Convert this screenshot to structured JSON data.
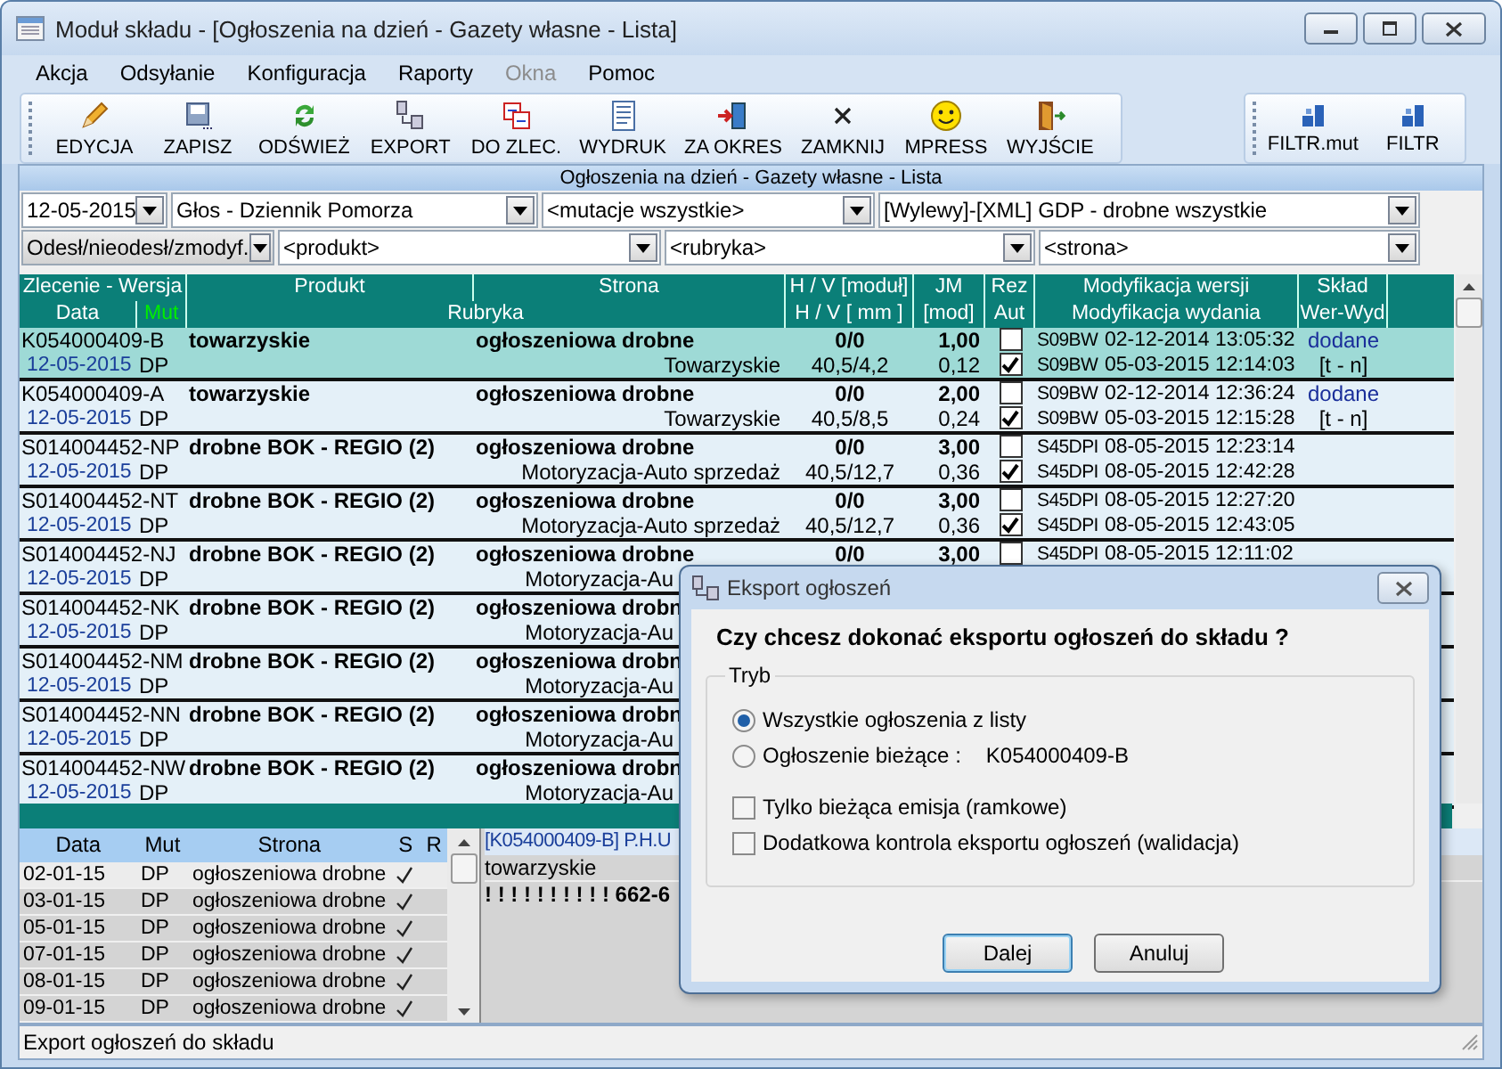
{
  "window": {
    "title": "Moduł składu - [Ogłoszenia na dzień - Gazety własne - Lista]"
  },
  "menu": [
    {
      "label": "Akcja",
      "disabled": false
    },
    {
      "label": "Odsyłanie",
      "disabled": false
    },
    {
      "label": "Konfiguracja",
      "disabled": false
    },
    {
      "label": "Raporty",
      "disabled": false
    },
    {
      "label": "Okna",
      "disabled": true
    },
    {
      "label": "Pomoc",
      "disabled": false
    }
  ],
  "toolbar": [
    "EDYCJA",
    "ZAPISZ",
    "ODŚWIEŻ",
    "EXPORT",
    "DO ZLEC.",
    "WYDRUK",
    "ZA OKRES",
    "ZAMKNIJ",
    "MPRESS",
    "WYJŚCIE"
  ],
  "toolbar_right": [
    "FILTR.mut",
    "FILTR"
  ],
  "panel_title": "Ogłoszenia na dzień - Gazety własne - Lista",
  "filters_row1": [
    "12-05-2015",
    "Głos - Dziennik Pomorza",
    "<mutacje wszystkie>",
    "[Wylewy]-[XML] GDP - drobne wszystkie"
  ],
  "filters_row2": [
    "Odesł/nieodesł/zmodyf.",
    "<produkt>",
    "<rubryka>",
    "<strona>"
  ],
  "table": {
    "header_top": [
      "Zlecenie - Wersja",
      "Produkt",
      "Strona",
      "H / V [moduł]",
      "JM",
      "Rez",
      "Modyfikacja wersji",
      "Skład"
    ],
    "header_bottom": [
      "Data",
      "Mut",
      "Rubryka",
      "H / V [  mm  ]",
      "[mod]",
      "Aut",
      "Modyfikacja wydania",
      "Wer-Wyd"
    ],
    "rows": [
      {
        "selected": true,
        "order": "K054000409-B",
        "product": "towarzyskie",
        "page": "ogłoszeniowa drobne",
        "hv_mod": "0/0",
        "jm": "1,00",
        "rez": false,
        "ver_code": "S09BW",
        "ver_time": "02-12-2014 13:05:32",
        "sklad": "dodane",
        "date": "12-05-2015",
        "mut": "DP",
        "rubric": "Towarzyskie",
        "hv_mm": "40,5/4,2",
        "jm_mod": "0,12",
        "aut": true,
        "ed_code": "S09BW",
        "ed_time": "05-03-2015 12:14:03",
        "sklad2": "[t - n]"
      },
      {
        "selected": false,
        "order": "K054000409-A",
        "product": "towarzyskie",
        "page": "ogłoszeniowa drobne",
        "hv_mod": "0/0",
        "jm": "2,00",
        "rez": false,
        "ver_code": "S09BW",
        "ver_time": "02-12-2014 12:36:24",
        "sklad": "dodane",
        "date": "12-05-2015",
        "mut": "DP",
        "rubric": "Towarzyskie",
        "hv_mm": "40,5/8,5",
        "jm_mod": "0,24",
        "aut": true,
        "ed_code": "S09BW",
        "ed_time": "05-03-2015 12:15:28",
        "sklad2": "[t - n]"
      },
      {
        "selected": false,
        "order": "S014004452-NP",
        "product": "drobne BOK - REGIO (2)",
        "page": "ogłoszeniowa drobne",
        "hv_mod": "0/0",
        "jm": "3,00",
        "rez": false,
        "ver_code": "S45DPI",
        "ver_time": "08-05-2015 12:23:14",
        "date": "12-05-2015",
        "mut": "DP",
        "rubric": "Motoryzacja-Auto sprzedaż",
        "hv_mm": "40,5/12,7",
        "jm_mod": "0,36",
        "aut": true,
        "ed_code": "S45DPI",
        "ed_time": "08-05-2015 12:42:28"
      },
      {
        "selected": false,
        "order": "S014004452-NT",
        "product": "drobne BOK - REGIO (2)",
        "page": "ogłoszeniowa drobne",
        "hv_mod": "0/0",
        "jm": "3,00",
        "rez": false,
        "ver_code": "S45DPI",
        "ver_time": "08-05-2015 12:27:20",
        "date": "12-05-2015",
        "mut": "DP",
        "rubric": "Motoryzacja-Auto sprzedaż",
        "hv_mm": "40,5/12,7",
        "jm_mod": "0,36",
        "aut": true,
        "ed_code": "S45DPI",
        "ed_time": "08-05-2015 12:43:05"
      },
      {
        "selected": false,
        "order": "S014004452-NJ",
        "product": "drobne BOK - REGIO (2)",
        "page": "ogłoszeniowa drobne",
        "hv_mod": "0/0",
        "jm": "3,00",
        "rez": false,
        "ver_code": "S45DPI",
        "ver_time": "08-05-2015 12:11:02",
        "date": "12-05-2015",
        "mut": "DP",
        "rubric": "Motoryzacja-Au"
      },
      {
        "selected": false,
        "order": "S014004452-NK",
        "product": "drobne BOK - REGIO (2)",
        "page": "ogłoszeniowa drobn",
        "date": "12-05-2015",
        "mut": "DP",
        "rubric": "Motoryzacja-Au"
      },
      {
        "selected": false,
        "order": "S014004452-NM",
        "product": "drobne BOK - REGIO (2)",
        "page": "ogłoszeniowa drobn",
        "date": "12-05-2015",
        "mut": "DP",
        "rubric": "Motoryzacja-Au"
      },
      {
        "selected": false,
        "order": "S014004452-NN",
        "product": "drobne BOK - REGIO (2)",
        "page": "ogłoszeniowa drobn",
        "date": "12-05-2015",
        "mut": "DP",
        "rubric": "Motoryzacja-Au"
      },
      {
        "selected": false,
        "order": "S014004452-NW",
        "product": "drobne BOK - REGIO (2)",
        "page": "ogłoszeniowa drobn",
        "date": "12-05-2015",
        "mut": "DP",
        "rubric": "Motoryzacja-Au"
      }
    ]
  },
  "dates_table": {
    "columns": [
      "Data",
      "Mut",
      "Strona",
      "S",
      "R"
    ],
    "rows": [
      {
        "selected": true,
        "date": "02-01-15",
        "mut": "DP",
        "page": "ogłoszeniowa drobne",
        "s": true
      },
      {
        "selected": false,
        "date": "03-01-15",
        "mut": "DP",
        "page": "ogłoszeniowa drobne",
        "s": true
      },
      {
        "selected": false,
        "date": "05-01-15",
        "mut": "DP",
        "page": "ogłoszeniowa drobne",
        "s": true
      },
      {
        "selected": false,
        "date": "07-01-15",
        "mut": "DP",
        "page": "ogłoszeniowa drobne",
        "s": true
      },
      {
        "selected": false,
        "date": "08-01-15",
        "mut": "DP",
        "page": "ogłoszeniowa drobne",
        "s": true
      },
      {
        "selected": false,
        "date": "09-01-15",
        "mut": "DP",
        "page": "ogłoszeniowa drobne",
        "s": true
      }
    ]
  },
  "preview": {
    "header": "[K054000409-B]  P.H.U",
    "line_1": "towarzyskie",
    "line_2": "! ! ! ! ! ! ! ! ! ! 662-6"
  },
  "status_bar": "Export ogłoszeń do składu",
  "dialog": {
    "title": "Eksport ogłoszeń",
    "question": "Czy chcesz dokonać eksportu ogłoszeń do składu ?",
    "group": "Tryb",
    "radios": [
      {
        "label": "Wszystkie ogłoszenia z listy",
        "selected": true
      },
      {
        "label": "Ogłoszenie bieżące :",
        "value": "K054000409-B",
        "selected": false
      }
    ],
    "checkboxes": [
      {
        "label": "Tylko bieżąca emisja (ramkowe)",
        "checked": false
      },
      {
        "label": "Dodatkowa kontrola eksportu ogłoszeń (walidacja)",
        "checked": false
      }
    ],
    "buttons": [
      {
        "label": "Dalej",
        "default": true
      },
      {
        "label": "Anuluj",
        "default": false
      }
    ]
  }
}
